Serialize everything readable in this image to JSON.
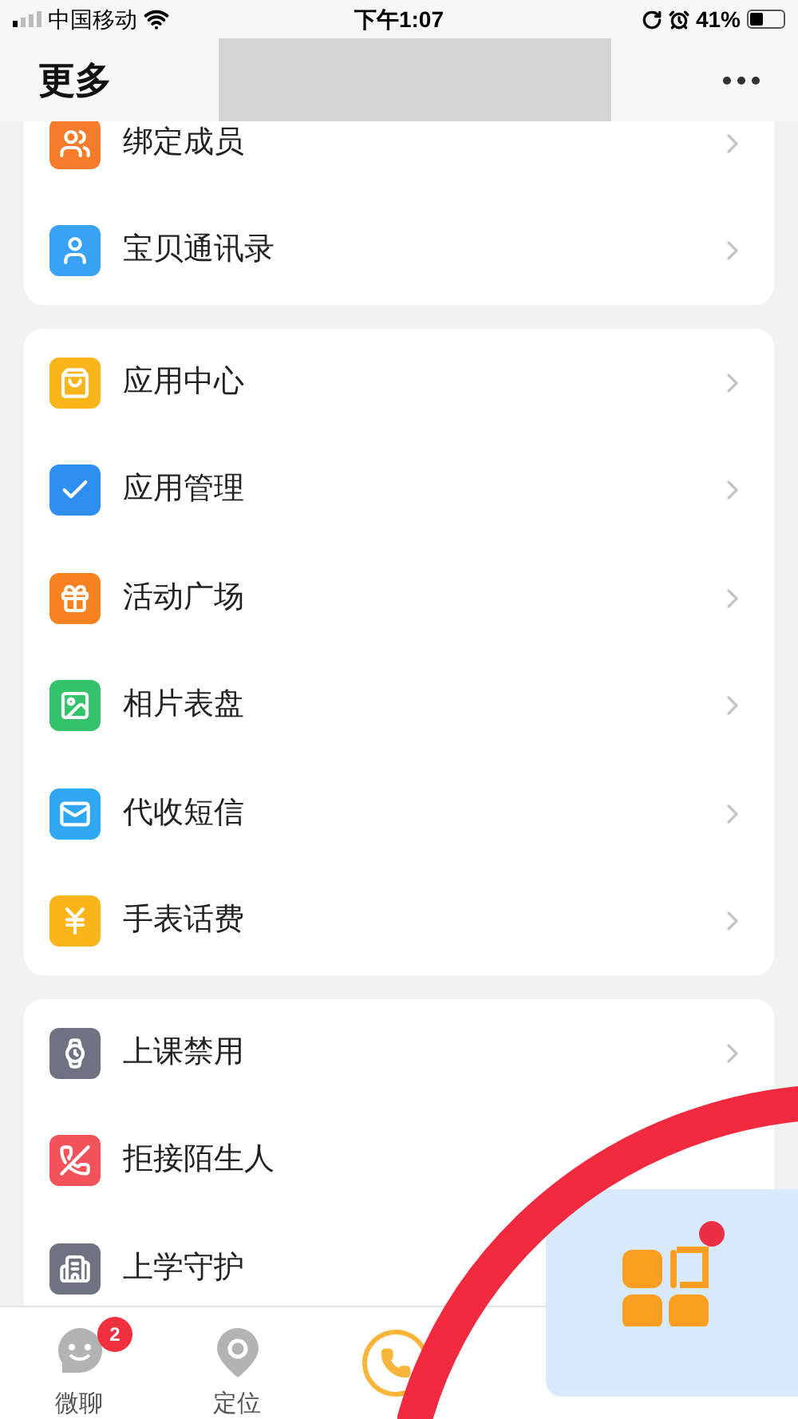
{
  "status_bar": {
    "carrier": "中国移动",
    "time": "下午1:07",
    "battery": "41%"
  },
  "header": {
    "title": "更多"
  },
  "sections": [
    {
      "items": [
        {
          "label": "绑定成员",
          "kind": "members",
          "color": "#f57c2a",
          "chevron": true
        },
        {
          "label": "宝贝通讯录",
          "kind": "contacts",
          "color": "#3aa2f5",
          "chevron": true
        }
      ]
    },
    {
      "items": [
        {
          "label": "应用中心",
          "kind": "bag",
          "color": "#fbb41a",
          "chevron": true
        },
        {
          "label": "应用管理",
          "kind": "check",
          "color": "#2e8ff0",
          "chevron": true
        },
        {
          "label": "活动广场",
          "kind": "gift",
          "color": "#f7821f",
          "chevron": true
        },
        {
          "label": "相片表盘",
          "kind": "photo",
          "color": "#34c26a",
          "chevron": true
        },
        {
          "label": "代收短信",
          "kind": "mail",
          "color": "#2fa7f2",
          "chevron": true
        },
        {
          "label": "手表话费",
          "kind": "yuan",
          "color": "#fbb41a",
          "chevron": true
        }
      ]
    },
    {
      "items": [
        {
          "label": "上课禁用",
          "kind": "watch",
          "color": "#6e7382",
          "chevron": true
        },
        {
          "label": "拒接陌生人",
          "kind": "block",
          "color": "#f2535a",
          "chevron": false
        },
        {
          "label": "上学守护",
          "kind": "building",
          "color": "#6e7382",
          "chevron": false
        }
      ]
    }
  ],
  "tab_bar": {
    "items": [
      {
        "label": "微聊",
        "kind": "chat",
        "badge": "2"
      },
      {
        "label": "定位",
        "kind": "location"
      },
      {
        "kind": "call"
      }
    ]
  }
}
